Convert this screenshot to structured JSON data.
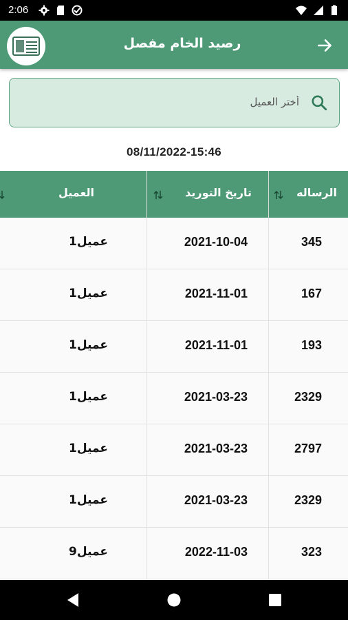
{
  "status_bar": {
    "time": "2:06",
    "left_icons": [
      "gear-icon",
      "sd-card-icon",
      "data-saver-icon"
    ],
    "right_icons": [
      "wifi-icon",
      "signal-icon",
      "battery-icon"
    ]
  },
  "app_bar": {
    "title": "رصيد الخام مفصل",
    "back_icon": "arrow-right-icon",
    "logo_icon": "company-logo",
    "background": "#4e9a77"
  },
  "search": {
    "placeholder": "أختر العميل",
    "value": "",
    "icon": "search-icon"
  },
  "timestamp": "08/11/2022-15:46",
  "table": {
    "columns": [
      {
        "label": "الرساله",
        "sort_icon": "sort-icon"
      },
      {
        "label": "تاريخ التوريد",
        "sort_icon": "sort-icon"
      },
      {
        "label": "العميل",
        "sort_icon": "sort-icon"
      }
    ],
    "rows": [
      {
        "ref": "345",
        "date": "2021-10-04",
        "client": "عميل1"
      },
      {
        "ref": "167",
        "date": "2021-11-01",
        "client": "عميل1"
      },
      {
        "ref": "193",
        "date": "2021-11-01",
        "client": "عميل1"
      },
      {
        "ref": "2329",
        "date": "2021-03-23",
        "client": "عميل1"
      },
      {
        "ref": "2797",
        "date": "2021-03-23",
        "client": "عميل1"
      },
      {
        "ref": "2329",
        "date": "2021-03-23",
        "client": "عميل1"
      },
      {
        "ref": "323",
        "date": "2022-11-03",
        "client": "عميل9"
      },
      {
        "ref": "",
        "date": "",
        "client": ""
      }
    ]
  },
  "nav_bar": {
    "icons": [
      "back-triangle-icon",
      "home-circle-icon",
      "recents-square-icon"
    ]
  }
}
